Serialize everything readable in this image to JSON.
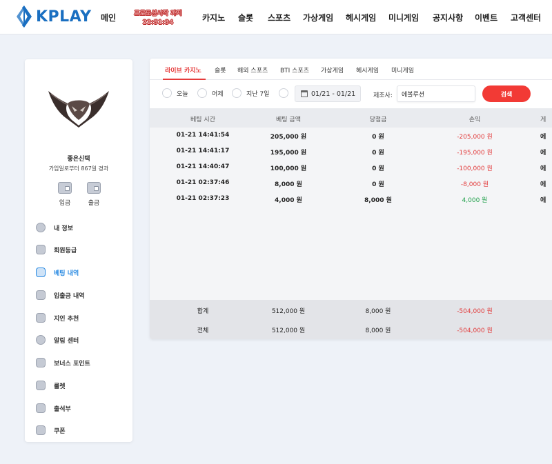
{
  "brand": {
    "logo_text": "KPLAY",
    "color": "#1a6fc1"
  },
  "nav": {
    "items": [
      "메인",
      "카지노",
      "슬롯",
      "스포츠",
      "가상게임",
      "헤시게임",
      "미니게임",
      "공지사항",
      "이벤트",
      "고객센터"
    ],
    "promo_line1": "프로모션시작 까지",
    "promo_line2": "22:51:34"
  },
  "user": {
    "name": "좋은신택",
    "since": "가입일로부터 867일 경과",
    "deposit": "입금",
    "withdraw": "출금"
  },
  "sidebar": {
    "items": [
      {
        "label": "내 정보",
        "icon": "smile-icon"
      },
      {
        "label": "회원등급",
        "icon": "heart-badge-icon"
      },
      {
        "label": "베팅 내역",
        "icon": "betting-list-icon",
        "active": true
      },
      {
        "label": "입출금 내역",
        "icon": "wallet-icon"
      },
      {
        "label": "지인 추천",
        "icon": "envelope-heart-icon"
      },
      {
        "label": "알림 센터",
        "icon": "chat-icon"
      },
      {
        "label": "보너스 포인트",
        "icon": "ticket-icon"
      },
      {
        "label": "룰렛",
        "icon": "roulette-icon"
      },
      {
        "label": "출석부",
        "icon": "calendar-check-icon"
      },
      {
        "label": "쿠폰",
        "icon": "coupon-icon"
      }
    ]
  },
  "tabs": [
    "라이브 카지노",
    "슬롯",
    "해외 스포츠",
    "BTI 스포츠",
    "가상게임",
    "헤시게임",
    "미니게임"
  ],
  "filter": {
    "options": [
      "오늘",
      "어제",
      "지난 7일"
    ],
    "date_range": "01/21 - 01/21",
    "vendor_label": "제조사:",
    "vendor_value": "에볼루션",
    "search_label": "검색"
  },
  "table": {
    "headers": [
      "베팅 시간",
      "베팅 금액",
      "당첨금",
      "손익",
      "게"
    ],
    "rows": [
      {
        "time": "01-21 14:41:54",
        "bet": "205,000 원",
        "win": "0 원",
        "pnl": "-205,000 원",
        "pnl_type": "neg",
        "extra": "에"
      },
      {
        "time": "01-21 14:41:17",
        "bet": "195,000 원",
        "win": "0 원",
        "pnl": "-195,000 원",
        "pnl_type": "neg",
        "extra": "에"
      },
      {
        "time": "01-21 14:40:47",
        "bet": "100,000 원",
        "win": "0 원",
        "pnl": "-100,000 원",
        "pnl_type": "neg",
        "extra": "에"
      },
      {
        "time": "01-21 02:37:46",
        "bet": "8,000 원",
        "win": "0 원",
        "pnl": "-8,000 원",
        "pnl_type": "neg",
        "extra": "에"
      },
      {
        "time": "01-21 02:37:23",
        "bet": "4,000 원",
        "win": "8,000 원",
        "pnl": "4,000 원",
        "pnl_type": "pos",
        "extra": "에"
      }
    ],
    "totals": [
      {
        "label": "합계",
        "bet": "512,000 원",
        "win": "8,000 원",
        "pnl": "-504,000 원"
      },
      {
        "label": "전체",
        "bet": "512,000 원",
        "win": "8,000 원",
        "pnl": "-504,000 원"
      }
    ]
  },
  "colors": {
    "accent_red": "#e53a3a",
    "active_blue": "#2b8be2",
    "positive": "#1fa04a"
  }
}
